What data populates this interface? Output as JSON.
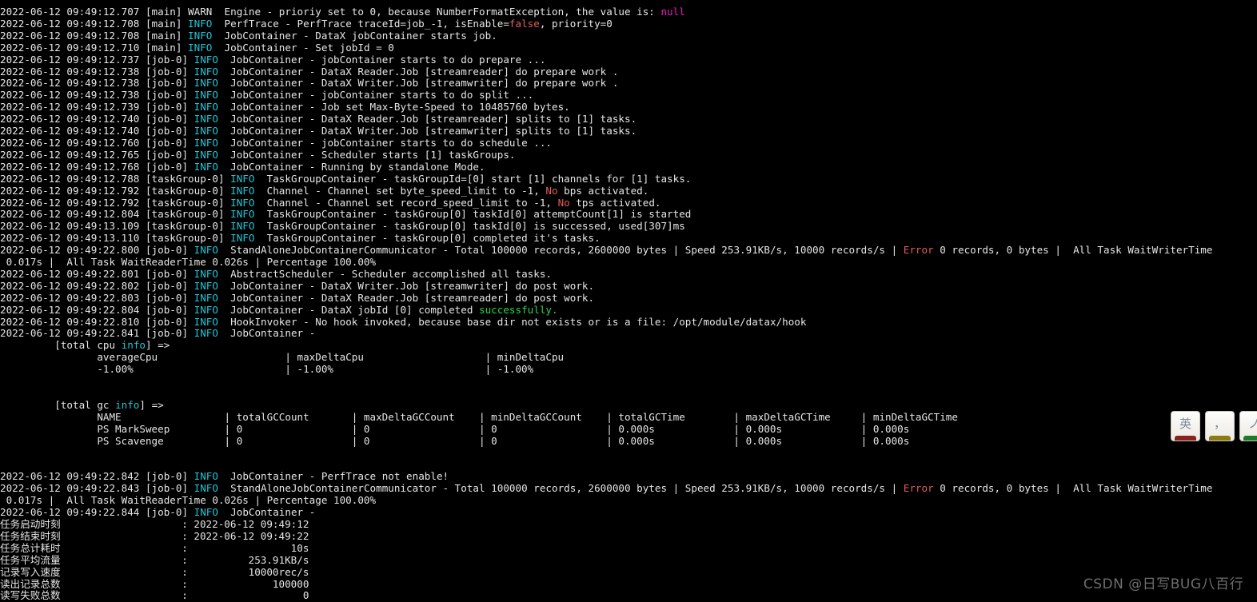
{
  "terminal": {
    "background_color": "#000000",
    "foreground_color": "#e6e6e6",
    "palette": {
      "cyan": "#1fc5d6",
      "red": "#e05c5c",
      "green": "#2fd14f",
      "magenta": "#f012be",
      "white": "#ffffff"
    },
    "lines": [
      {
        "id": "log-001",
        "segments": [
          {
            "text": "2022-06-12 09:49:12.707 [main] ",
            "color": "default"
          },
          {
            "text": "WARN ",
            "color": "default"
          },
          {
            "text": " Engine - prioriy set to 0, because NumberFormatException, the value is: ",
            "color": "default"
          },
          {
            "text": "null",
            "color": "magenta"
          }
        ]
      },
      {
        "id": "log-002",
        "segments": [
          {
            "text": "2022-06-12 09:49:12.708 [main] ",
            "color": "default"
          },
          {
            "text": "INFO",
            "color": "cyan"
          },
          {
            "text": "  PerfTrace - PerfTrace traceId=job_-1, isEnable=",
            "color": "default"
          },
          {
            "text": "false",
            "color": "red"
          },
          {
            "text": ", priority=0",
            "color": "default"
          }
        ]
      },
      {
        "id": "log-003",
        "segments": [
          {
            "text": "2022-06-12 09:49:12.708 [main] ",
            "color": "default"
          },
          {
            "text": "INFO",
            "color": "cyan"
          },
          {
            "text": "  JobContainer - DataX jobContainer starts job.",
            "color": "default"
          }
        ]
      },
      {
        "id": "log-004",
        "segments": [
          {
            "text": "2022-06-12 09:49:12.710 [main] ",
            "color": "default"
          },
          {
            "text": "INFO",
            "color": "cyan"
          },
          {
            "text": "  JobContainer - Set jobId = 0",
            "color": "default"
          }
        ]
      },
      {
        "id": "log-005",
        "segments": [
          {
            "text": "2022-06-12 09:49:12.737 [job-0] ",
            "color": "default"
          },
          {
            "text": "INFO",
            "color": "cyan"
          },
          {
            "text": "  JobContainer - jobContainer starts to do prepare ...",
            "color": "default"
          }
        ]
      },
      {
        "id": "log-006",
        "segments": [
          {
            "text": "2022-06-12 09:49:12.738 [job-0] ",
            "color": "default"
          },
          {
            "text": "INFO",
            "color": "cyan"
          },
          {
            "text": "  JobContainer - DataX Reader.Job [streamreader] do prepare work .",
            "color": "default"
          }
        ]
      },
      {
        "id": "log-007",
        "segments": [
          {
            "text": "2022-06-12 09:49:12.738 [job-0] ",
            "color": "default"
          },
          {
            "text": "INFO",
            "color": "cyan"
          },
          {
            "text": "  JobContainer - DataX Writer.Job [streamwriter] do prepare work .",
            "color": "default"
          }
        ]
      },
      {
        "id": "log-008",
        "segments": [
          {
            "text": "2022-06-12 09:49:12.738 [job-0] ",
            "color": "default"
          },
          {
            "text": "INFO",
            "color": "cyan"
          },
          {
            "text": "  JobContainer - jobContainer starts to do split ...",
            "color": "default"
          }
        ]
      },
      {
        "id": "log-009",
        "segments": [
          {
            "text": "2022-06-12 09:49:12.739 [job-0] ",
            "color": "default"
          },
          {
            "text": "INFO",
            "color": "cyan"
          },
          {
            "text": "  JobContainer - Job set Max-Byte-Speed to 10485760 bytes.",
            "color": "default"
          }
        ]
      },
      {
        "id": "log-010",
        "segments": [
          {
            "text": "2022-06-12 09:49:12.740 [job-0] ",
            "color": "default"
          },
          {
            "text": "INFO",
            "color": "cyan"
          },
          {
            "text": "  JobContainer - DataX Reader.Job [streamreader] splits to [1] tasks.",
            "color": "default"
          }
        ]
      },
      {
        "id": "log-011",
        "segments": [
          {
            "text": "2022-06-12 09:49:12.740 [job-0] ",
            "color": "default"
          },
          {
            "text": "INFO",
            "color": "cyan"
          },
          {
            "text": "  JobContainer - DataX Writer.Job [streamwriter] splits to [1] tasks.",
            "color": "default"
          }
        ]
      },
      {
        "id": "log-012",
        "segments": [
          {
            "text": "2022-06-12 09:49:12.760 [job-0] ",
            "color": "default"
          },
          {
            "text": "INFO",
            "color": "cyan"
          },
          {
            "text": "  JobContainer - jobContainer starts to do schedule ...",
            "color": "default"
          }
        ]
      },
      {
        "id": "log-013",
        "segments": [
          {
            "text": "2022-06-12 09:49:12.765 [job-0] ",
            "color": "default"
          },
          {
            "text": "INFO",
            "color": "cyan"
          },
          {
            "text": "  JobContainer - Scheduler starts [1] taskGroups.",
            "color": "default"
          }
        ]
      },
      {
        "id": "log-014",
        "segments": [
          {
            "text": "2022-06-12 09:49:12.768 [job-0] ",
            "color": "default"
          },
          {
            "text": "INFO",
            "color": "cyan"
          },
          {
            "text": "  JobContainer - Running by standalone Mode.",
            "color": "default"
          }
        ]
      },
      {
        "id": "log-015",
        "segments": [
          {
            "text": "2022-06-12 09:49:12.788 [taskGroup-0] ",
            "color": "default"
          },
          {
            "text": "INFO",
            "color": "cyan"
          },
          {
            "text": "  TaskGroupContainer - taskGroupId=[0] start [1] channels for [1] tasks.",
            "color": "default"
          }
        ]
      },
      {
        "id": "log-016",
        "segments": [
          {
            "text": "2022-06-12 09:49:12.792 [taskGroup-0] ",
            "color": "default"
          },
          {
            "text": "INFO",
            "color": "cyan"
          },
          {
            "text": "  Channel - Channel set byte_speed_limit to -1, ",
            "color": "default"
          },
          {
            "text": "No",
            "color": "red"
          },
          {
            "text": " bps activated.",
            "color": "default"
          }
        ]
      },
      {
        "id": "log-017",
        "segments": [
          {
            "text": "2022-06-12 09:49:12.792 [taskGroup-0] ",
            "color": "default"
          },
          {
            "text": "INFO",
            "color": "cyan"
          },
          {
            "text": "  Channel - Channel set record_speed_limit to -1, ",
            "color": "default"
          },
          {
            "text": "No",
            "color": "red"
          },
          {
            "text": " tps activated.",
            "color": "default"
          }
        ]
      },
      {
        "id": "log-018",
        "segments": [
          {
            "text": "2022-06-12 09:49:12.804 [taskGroup-0] ",
            "color": "default"
          },
          {
            "text": "INFO",
            "color": "cyan"
          },
          {
            "text": "  TaskGroupContainer - taskGroup[0] taskId[0] attemptCount[1] is started",
            "color": "default"
          }
        ]
      },
      {
        "id": "log-019",
        "segments": [
          {
            "text": "2022-06-12 09:49:13.109 [taskGroup-0] ",
            "color": "default"
          },
          {
            "text": "INFO",
            "color": "cyan"
          },
          {
            "text": "  TaskGroupContainer - taskGroup[0] taskId[0] is successed, used[307]ms",
            "color": "default"
          }
        ]
      },
      {
        "id": "log-020",
        "segments": [
          {
            "text": "2022-06-12 09:49:13.110 [taskGroup-0] ",
            "color": "default"
          },
          {
            "text": "INFO",
            "color": "cyan"
          },
          {
            "text": "  TaskGroupContainer - taskGroup[0] completed it's tasks.",
            "color": "default"
          }
        ]
      },
      {
        "id": "log-021",
        "segments": [
          {
            "text": "2022-06-12 09:49:22.800 [job-0] ",
            "color": "default"
          },
          {
            "text": "INFO",
            "color": "cyan"
          },
          {
            "text": "  StandAloneJobContainerCommunicator - Total 100000 records, 2600000 bytes | Speed 253.91KB/s, 10000 records/s | ",
            "color": "default"
          },
          {
            "text": "Error",
            "color": "red"
          },
          {
            "text": " 0 records, 0 bytes |  All Task WaitWriterTime",
            "color": "default"
          }
        ]
      },
      {
        "id": "log-022",
        "segments": [
          {
            "text": " 0.017s |  All Task WaitReaderTime 0.026s | Percentage 100.00%",
            "color": "default"
          }
        ]
      },
      {
        "id": "log-023",
        "segments": [
          {
            "text": "2022-06-12 09:49:22.801 [job-0] ",
            "color": "default"
          },
          {
            "text": "INFO",
            "color": "cyan"
          },
          {
            "text": "  AbstractScheduler - Scheduler accomplished all tasks.",
            "color": "default"
          }
        ]
      },
      {
        "id": "log-024",
        "segments": [
          {
            "text": "2022-06-12 09:49:22.802 [job-0] ",
            "color": "default"
          },
          {
            "text": "INFO",
            "color": "cyan"
          },
          {
            "text": "  JobContainer - DataX Writer.Job [streamwriter] do post work.",
            "color": "default"
          }
        ]
      },
      {
        "id": "log-025",
        "segments": [
          {
            "text": "2022-06-12 09:49:22.803 [job-0] ",
            "color": "default"
          },
          {
            "text": "INFO",
            "color": "cyan"
          },
          {
            "text": "  JobContainer - DataX Reader.Job [streamreader] do post work.",
            "color": "default"
          }
        ]
      },
      {
        "id": "log-026",
        "segments": [
          {
            "text": "2022-06-12 09:49:22.804 [job-0] ",
            "color": "default"
          },
          {
            "text": "INFO",
            "color": "cyan"
          },
          {
            "text": "  JobContainer - DataX jobId [0] completed ",
            "color": "default"
          },
          {
            "text": "successfully.",
            "color": "green"
          }
        ]
      },
      {
        "id": "log-027",
        "segments": [
          {
            "text": "2022-06-12 09:49:22.810 [job-0] ",
            "color": "default"
          },
          {
            "text": "INFO",
            "color": "cyan"
          },
          {
            "text": "  HookInvoker - No hook invoked, because base dir not exists or is a file: /opt/module/datax/hook",
            "color": "default"
          }
        ]
      },
      {
        "id": "log-028",
        "segments": [
          {
            "text": "2022-06-12 09:49:22.841 [job-0] ",
            "color": "default"
          },
          {
            "text": "INFO",
            "color": "cyan"
          },
          {
            "text": "  JobContainer - ",
            "color": "default"
          }
        ]
      },
      {
        "id": "cpu-header",
        "segments": [
          {
            "text": "         [total cpu ",
            "color": "default"
          },
          {
            "text": "info",
            "color": "cyan"
          },
          {
            "text": "] =>",
            "color": "default"
          }
        ]
      },
      {
        "id": "cpu-columns",
        "segments": [
          {
            "text": "                averageCpu                     | maxDeltaCpu                    | minDeltaCpu                    ",
            "color": "default"
          }
        ]
      },
      {
        "id": "cpu-values",
        "segments": [
          {
            "text": "                -1.00%                         | -1.00%                         | -1.00%                         ",
            "color": "default"
          }
        ]
      },
      {
        "id": "spacer-1",
        "segments": [
          {
            "text": " ",
            "color": "default"
          }
        ]
      },
      {
        "id": "spacer-2",
        "segments": [
          {
            "text": " ",
            "color": "default"
          }
        ]
      },
      {
        "id": "gc-header",
        "segments": [
          {
            "text": "         [total gc ",
            "color": "default"
          },
          {
            "text": "info",
            "color": "cyan"
          },
          {
            "text": "] =>",
            "color": "default"
          }
        ]
      },
      {
        "id": "gc-columns",
        "segments": [
          {
            "text": "                NAME                 | totalGCCount       | maxDeltaGCCount    | minDeltaGCCount    | totalGCTime        | maxDeltaGCTime     | minDeltaGCTime     ",
            "color": "default"
          }
        ]
      },
      {
        "id": "gc-row-marksweep",
        "segments": [
          {
            "text": "                PS MarkSweep         | 0                  | 0                  | 0                  | 0.000s             | 0.000s             | 0.000s             ",
            "color": "default"
          }
        ]
      },
      {
        "id": "gc-row-scavenge",
        "segments": [
          {
            "text": "                PS Scavenge          | 0                  | 0                  | 0                  | 0.000s             | 0.000s             | 0.000s             ",
            "color": "default"
          }
        ]
      },
      {
        "id": "spacer-3",
        "segments": [
          {
            "text": " ",
            "color": "default"
          }
        ]
      },
      {
        "id": "spacer-4",
        "segments": [
          {
            "text": " ",
            "color": "default"
          }
        ]
      },
      {
        "id": "log-029",
        "segments": [
          {
            "text": "2022-06-12 09:49:22.842 [job-0] ",
            "color": "default"
          },
          {
            "text": "INFO",
            "color": "cyan"
          },
          {
            "text": "  JobContainer - PerfTrace not enable!",
            "color": "default"
          }
        ]
      },
      {
        "id": "log-030",
        "segments": [
          {
            "text": "2022-06-12 09:49:22.843 [job-0] ",
            "color": "default"
          },
          {
            "text": "INFO",
            "color": "cyan"
          },
          {
            "text": "  StandAloneJobContainerCommunicator - Total 100000 records, 2600000 bytes | Speed 253.91KB/s, 10000 records/s | ",
            "color": "default"
          },
          {
            "text": "Error",
            "color": "red"
          },
          {
            "text": " 0 records, 0 bytes |  All Task WaitWriterTime",
            "color": "default"
          }
        ]
      },
      {
        "id": "log-031",
        "segments": [
          {
            "text": " 0.017s |  All Task WaitReaderTime 0.026s | Percentage 100.00%",
            "color": "default"
          }
        ]
      },
      {
        "id": "log-032",
        "segments": [
          {
            "text": "2022-06-12 09:49:22.844 [job-0] ",
            "color": "default"
          },
          {
            "text": "INFO",
            "color": "cyan"
          },
          {
            "text": "  JobContainer - ",
            "color": "default"
          }
        ]
      },
      {
        "id": "summary-start-time",
        "segments": [
          {
            "text": "任务启动时刻                    : 2022-06-12 09:49:12",
            "color": "default"
          }
        ]
      },
      {
        "id": "summary-end-time",
        "segments": [
          {
            "text": "任务结束时刻                    : 2022-06-12 09:49:22",
            "color": "default"
          }
        ]
      },
      {
        "id": "summary-total-elapsed",
        "segments": [
          {
            "text": "任务总计耗时                    :                 10s",
            "color": "default"
          }
        ]
      },
      {
        "id": "summary-average-flow",
        "segments": [
          {
            "text": "任务平均流量                    :          253.91KB/s",
            "color": "default"
          }
        ]
      },
      {
        "id": "summary-write-speed",
        "segments": [
          {
            "text": "记录写入速度                    :          10000rec/s",
            "color": "default"
          }
        ]
      },
      {
        "id": "summary-read-records",
        "segments": [
          {
            "text": "读出记录总数                    :              100000",
            "color": "default"
          }
        ]
      },
      {
        "id": "summary-failed-records",
        "segments": [
          {
            "text": "读写失败总数                    :                   0",
            "color": "default"
          }
        ]
      }
    ]
  },
  "ime_toolbar": {
    "keys": [
      {
        "name": "language-mode",
        "glyph": "英",
        "underbar_color": "#8d2020"
      },
      {
        "name": "punctuation-mode",
        "glyph": "，",
        "underbar_color": "#8d7a10"
      },
      {
        "name": "extra-mode",
        "glyph": "ノ",
        "underbar_color": "#1c7a27"
      }
    ]
  },
  "watermark": {
    "text": "CSDN @日写BUG八百行"
  }
}
